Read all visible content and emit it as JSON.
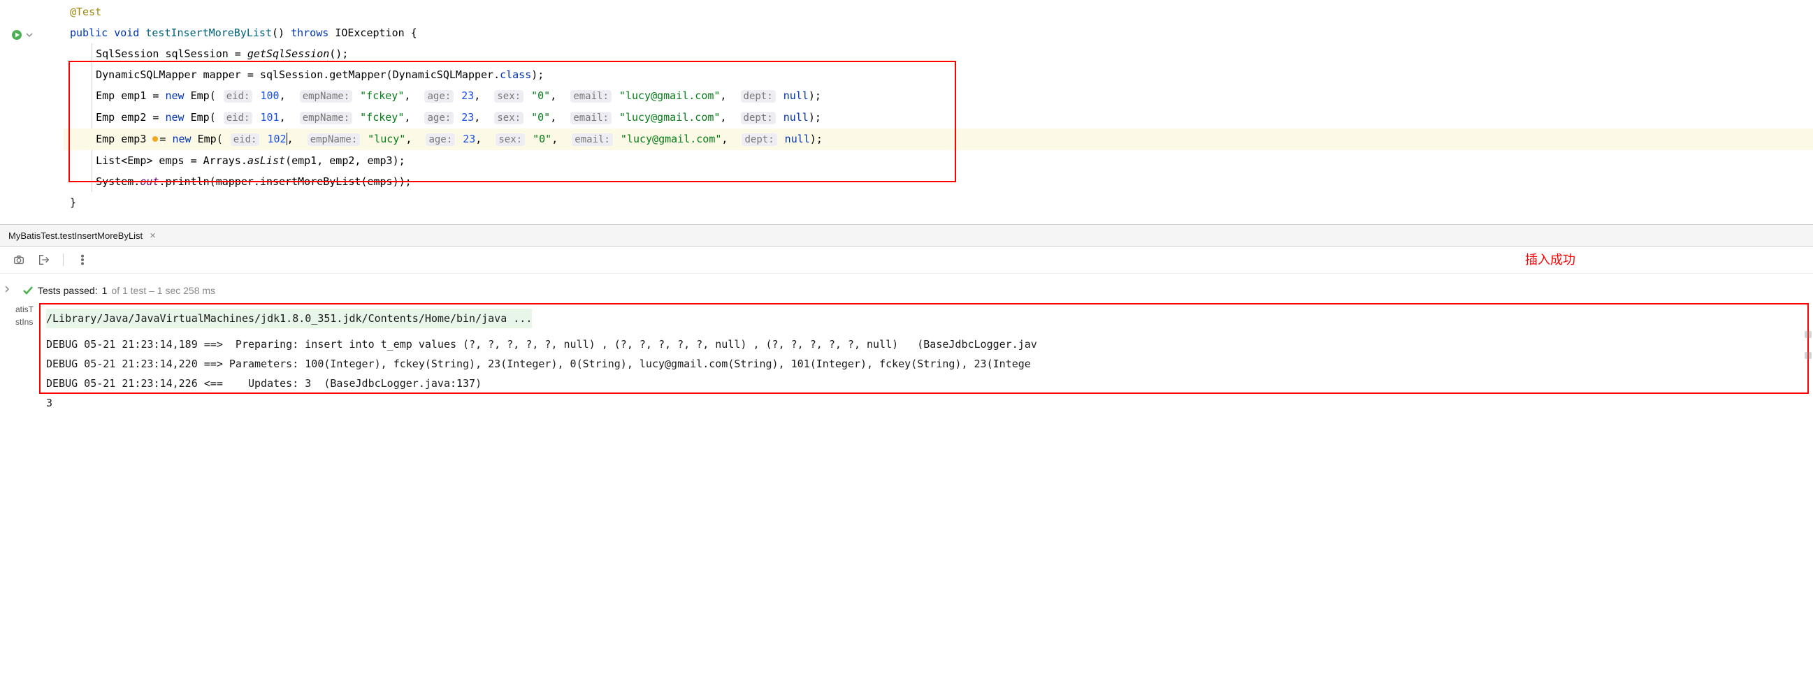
{
  "code": {
    "annotation": "@Test",
    "sig": {
      "public": "public",
      "void": "void",
      "name": "testInsertMoreByList",
      "throws": "throws",
      "exc": "IOException"
    },
    "l_session_decl": "SqlSession sqlSession = ",
    "l_session_call": "getSqlSession",
    "l_mapper_decl": "DynamicSQLMapper mapper = sqlSession.getMapper(DynamicSQLMapper.",
    "l_mapper_class": "class",
    "emp_rows": [
      {
        "var": "emp1",
        "eid": "100",
        "name": "\"fckey\"",
        "age": "23",
        "sex": "\"0\"",
        "email": "\"lucy@gmail.com\"",
        "dept": "null"
      },
      {
        "var": "emp2",
        "eid": "101",
        "name": "\"fckey\"",
        "age": "23",
        "sex": "\"0\"",
        "email": "\"lucy@gmail.com\"",
        "dept": "null"
      },
      {
        "var": "emp3",
        "eid": "102",
        "name": "\"lucy\"",
        "age": "23",
        "sex": "\"0\"",
        "email": "\"lucy@gmail.com\"",
        "dept": "null"
      }
    ],
    "hints": {
      "eid": "eid:",
      "empName": "empName:",
      "age": "age:",
      "sex": "sex:",
      "email": "email:",
      "dept": "dept:"
    },
    "new": "new",
    "Emp": "Emp",
    "List": "List",
    "Arrays": "Arrays",
    "asList": "asList",
    "l_list": " emps = ",
    "l_list_args": "(emp1, emp2, emp3);",
    "l_sys": "System.",
    "out": "out",
    "println": ".println(mapper.insertMoreByList(emps));",
    "close_brace": "}"
  },
  "tab": {
    "label": "MyBatisTest.testInsertMoreByList"
  },
  "insert_success_label": "插入成功",
  "tests": {
    "label": "Tests passed:",
    "count": "1",
    "detail": "of 1 test – 1 sec 258 ms"
  },
  "sidetabs": {
    "a": "atisT",
    "b": "stIns"
  },
  "console": {
    "cmd": "/Library/Java/JavaVirtualMachines/jdk1.8.0_351.jdk/Contents/Home/bin/java ...",
    "l1": "DEBUG 05-21 21:23:14,189 ==>  Preparing: insert into t_emp values (?, ?, ?, ?, ?, null) , (?, ?, ?, ?, ?, null) , (?, ?, ?, ?, ?, null)   (BaseJdbcLogger.jav",
    "l2": "DEBUG 05-21 21:23:14,220 ==> Parameters: 100(Integer), fckey(String), 23(Integer), 0(String), lucy@gmail.com(String), 101(Integer), fckey(String), 23(Intege",
    "l3": "DEBUG 05-21 21:23:14,226 <==    Updates: 3  (BaseJdbcLogger.java:137)",
    "l4": "3"
  }
}
